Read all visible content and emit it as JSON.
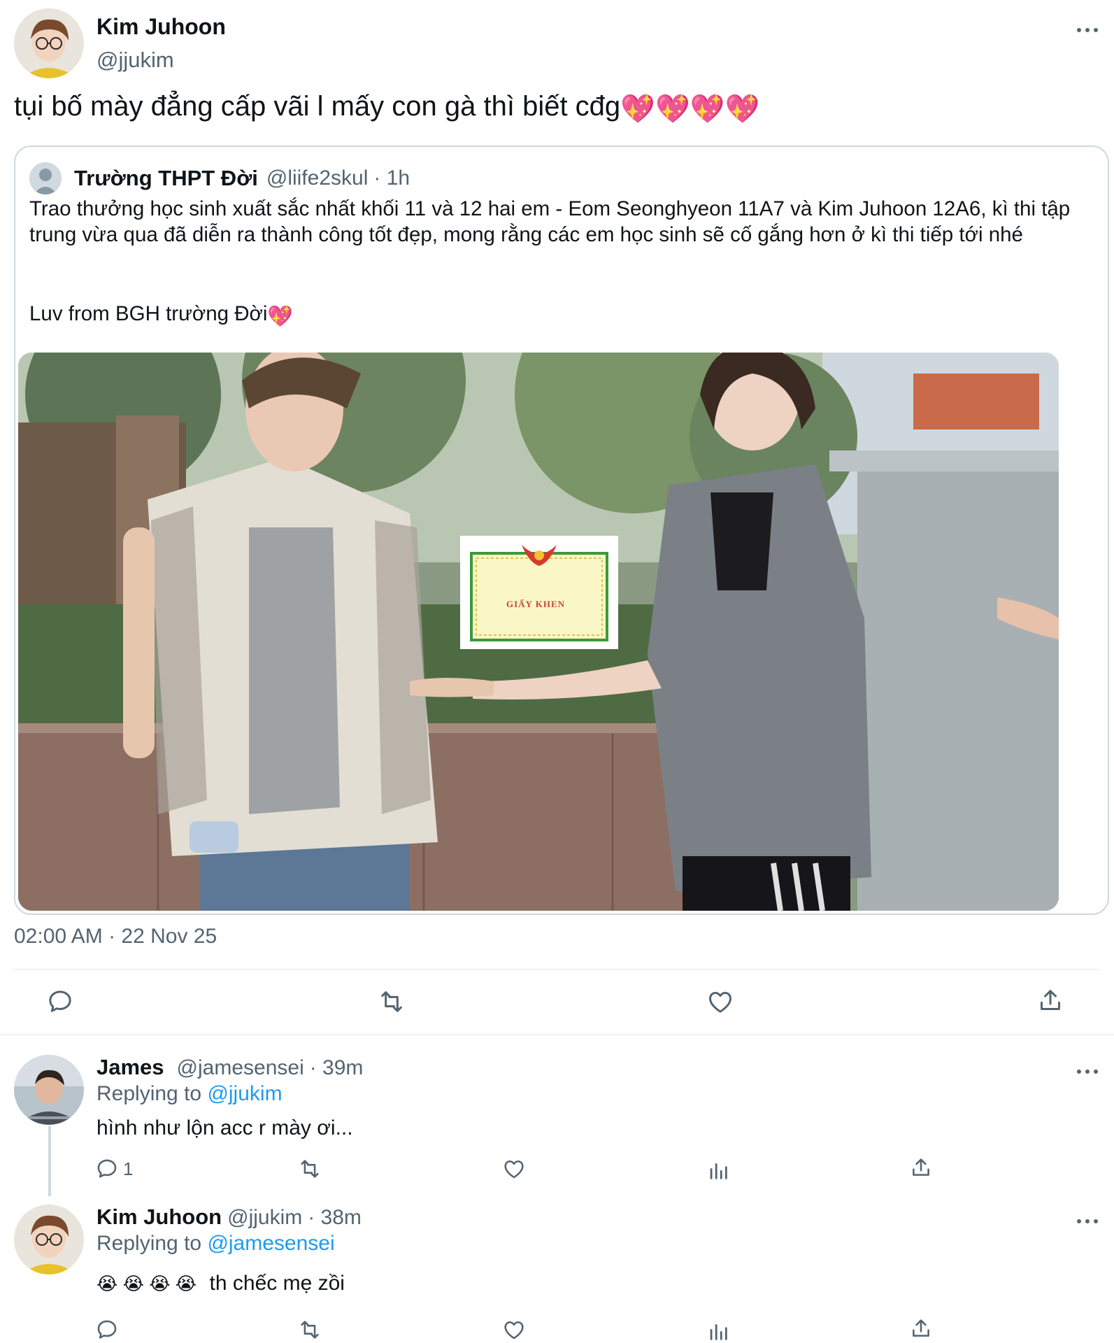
{
  "tweet": {
    "author_name": "Kim Juhoon",
    "author_handle": "@jjukim",
    "text": "tụi bố mày đẳng cấp vãi l mấy con gà thì biết cđg",
    "text_emoji": "💖💖💖💖",
    "timestamp": "02:00 AM · 22 Nov 25",
    "more_icon": "more-horizontal-icon"
  },
  "quote": {
    "author_name": "Trường THPT Đời",
    "author_handle": "@liife2skul",
    "time": "· 1h",
    "text": "Trao thưởng học sinh xuất sắc nhất khối 11 và 12 hai em - Eom Seonghyeon 11A7 và Kim Juhoon 12A6, kì thi tập trung vừa qua đã diễn ra thành công tốt đẹp, mong rằng các em học sinh sẽ cố gắng hơn ở kì thi tiếp tới nhé",
    "sign": "Luv from BGH trường Đời",
    "sign_emoji": "💖",
    "certificate_text": "GIẤY KHEN"
  },
  "actions": {
    "reply_icon": "reply-icon",
    "retweet_icon": "retweet-icon",
    "like_icon": "heart-icon",
    "share_icon": "share-icon"
  },
  "replies": [
    {
      "author_name": "James",
      "author_handle": "@jamesensei",
      "time": "· 39m",
      "replying_prefix": "Replying to",
      "replying_to": "@jjukim",
      "text": "hình như lộn acc r mày ơi...",
      "reply_count": "1"
    },
    {
      "author_name": "Kim Juhoon",
      "author_handle": "@jjukim",
      "time": "· 38m",
      "replying_prefix": "Replying to",
      "replying_to": "@jamesensei",
      "emoji": "😭 😭 😭 😭",
      "text": "th chếc mẹ zồi"
    }
  ],
  "colors": {
    "text": "#0f1419",
    "muted": "#536471",
    "link": "#1d9bf0",
    "border": "#cfd9de",
    "divider": "#eff3f4"
  }
}
